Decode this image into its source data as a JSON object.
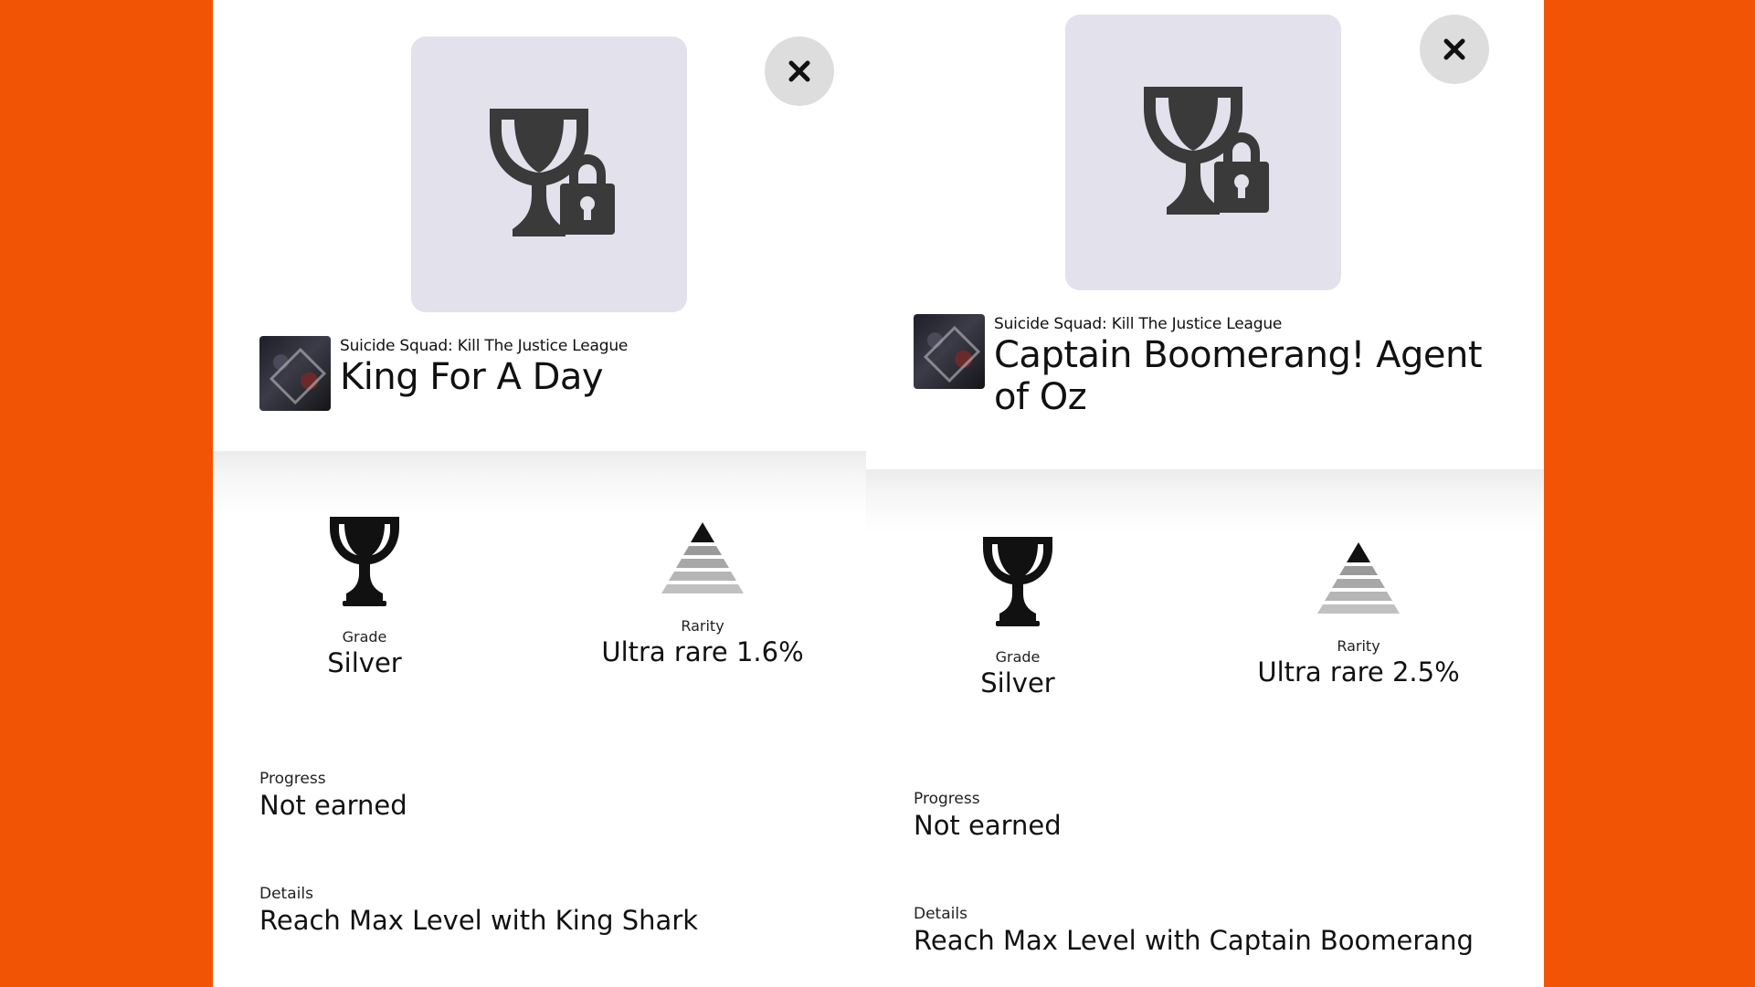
{
  "colors": {
    "background": "#f25406",
    "art_bg": "#e2e1ec",
    "close_bg": "#dddddd"
  },
  "panels": [
    {
      "art_icon": "trophy-locked-icon",
      "close_icon": "close-icon",
      "game_name": "Suicide Squad: Kill The Justice League",
      "trophy_name": "King For A Day",
      "grade_label": "Grade",
      "grade_value": "Silver",
      "grade_icon": "trophy-icon",
      "rarity_label": "Rarity",
      "rarity_value": "Ultra rare 1.6%",
      "rarity_icon": "rarity-pyramid-icon",
      "progress_label": "Progress",
      "progress_value": "Not earned",
      "details_label": "Details",
      "details_value": "Reach Max Level with King Shark"
    },
    {
      "art_icon": "trophy-locked-icon",
      "close_icon": "close-icon",
      "game_name": "Suicide Squad: Kill The Justice League",
      "trophy_name": "Captain Boomerang! Agent of Oz",
      "grade_label": "Grade",
      "grade_value": "Silver",
      "grade_icon": "trophy-icon",
      "rarity_label": "Rarity",
      "rarity_value": "Ultra rare 2.5%",
      "rarity_icon": "rarity-pyramid-icon",
      "progress_label": "Progress",
      "progress_value": "Not earned",
      "details_label": "Details",
      "details_value": "Reach Max Level with Captain Boomerang"
    }
  ]
}
